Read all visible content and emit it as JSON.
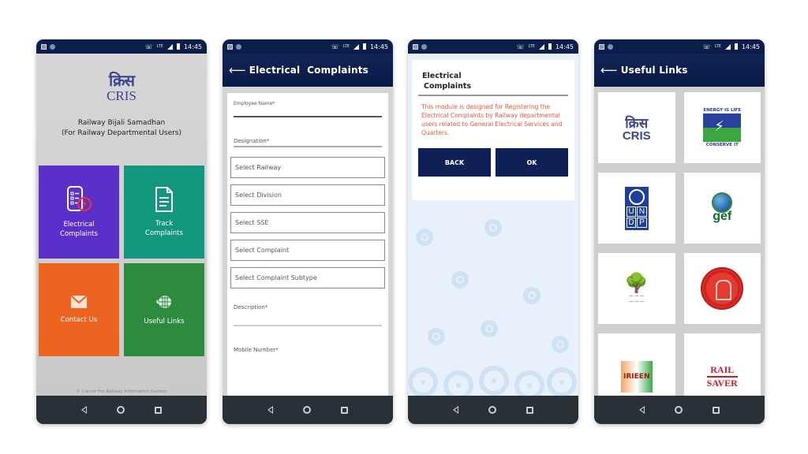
{
  "status_bar": {
    "time": "14:45",
    "network": "LTE"
  },
  "screens": {
    "home": {
      "logo_hindi": "क्रिस",
      "logo_text": "CRIS",
      "title_line1": "Railway Bijali Samadhan",
      "title_line2": "(For Railway Departmental Users)",
      "tiles": [
        {
          "label_line1": "Electrical",
          "label_line2": "Complaints",
          "color": "#5b30c9"
        },
        {
          "label_line1": "Track",
          "label_line2": "Complaints",
          "color": "#12977e"
        },
        {
          "label_line1": "Contact Us",
          "label_line2": "",
          "color": "#ec6420"
        },
        {
          "label_line1": "Useful Links",
          "label_line2": "",
          "color": "#2c8b3d"
        }
      ],
      "footer": "© Center For Railway Information System"
    },
    "form": {
      "title": "Electrical  Complaints",
      "fields": {
        "employee_name": "Employee Name*",
        "designation": "Designation*",
        "description": "Description*",
        "mobile": "Mobile Number*"
      },
      "selects": [
        "Select Railway",
        "Select Division",
        "Select SSE",
        "Select Complaint",
        "Select Complaint Subtype"
      ]
    },
    "dialog": {
      "title_line1": "Electrical",
      "title_line2": "Complaints",
      "message": "This module is designed for Registering the Electrical Complaints by Railway departmental users related to General Electrical Services and Quarters.",
      "back_label": "BACK",
      "ok_label": "OK",
      "message_color": "#e4573c"
    },
    "links": {
      "title": "Useful Links",
      "items": [
        {
          "name": "CRIS",
          "hindi": "क्रिस"
        },
        {
          "name": "Energy Is Life Conserve It",
          "top": "ENERGY IS LIFE",
          "bottom": "CONSERVE IT"
        },
        {
          "name": "UNDP",
          "letters": [
            "U",
            "N",
            "D",
            "P"
          ]
        },
        {
          "name": "gef",
          "text": "gef"
        },
        {
          "name": "Green Tree Logo"
        },
        {
          "name": "Indian Railways"
        },
        {
          "name": "IRIEEN",
          "text": "IRIEEN"
        },
        {
          "name": "Rail Saver",
          "top": "RAIL",
          "bottom": "SAVER"
        }
      ]
    }
  },
  "navbar": {
    "back": "back",
    "home": "home",
    "recent": "recent-apps"
  }
}
